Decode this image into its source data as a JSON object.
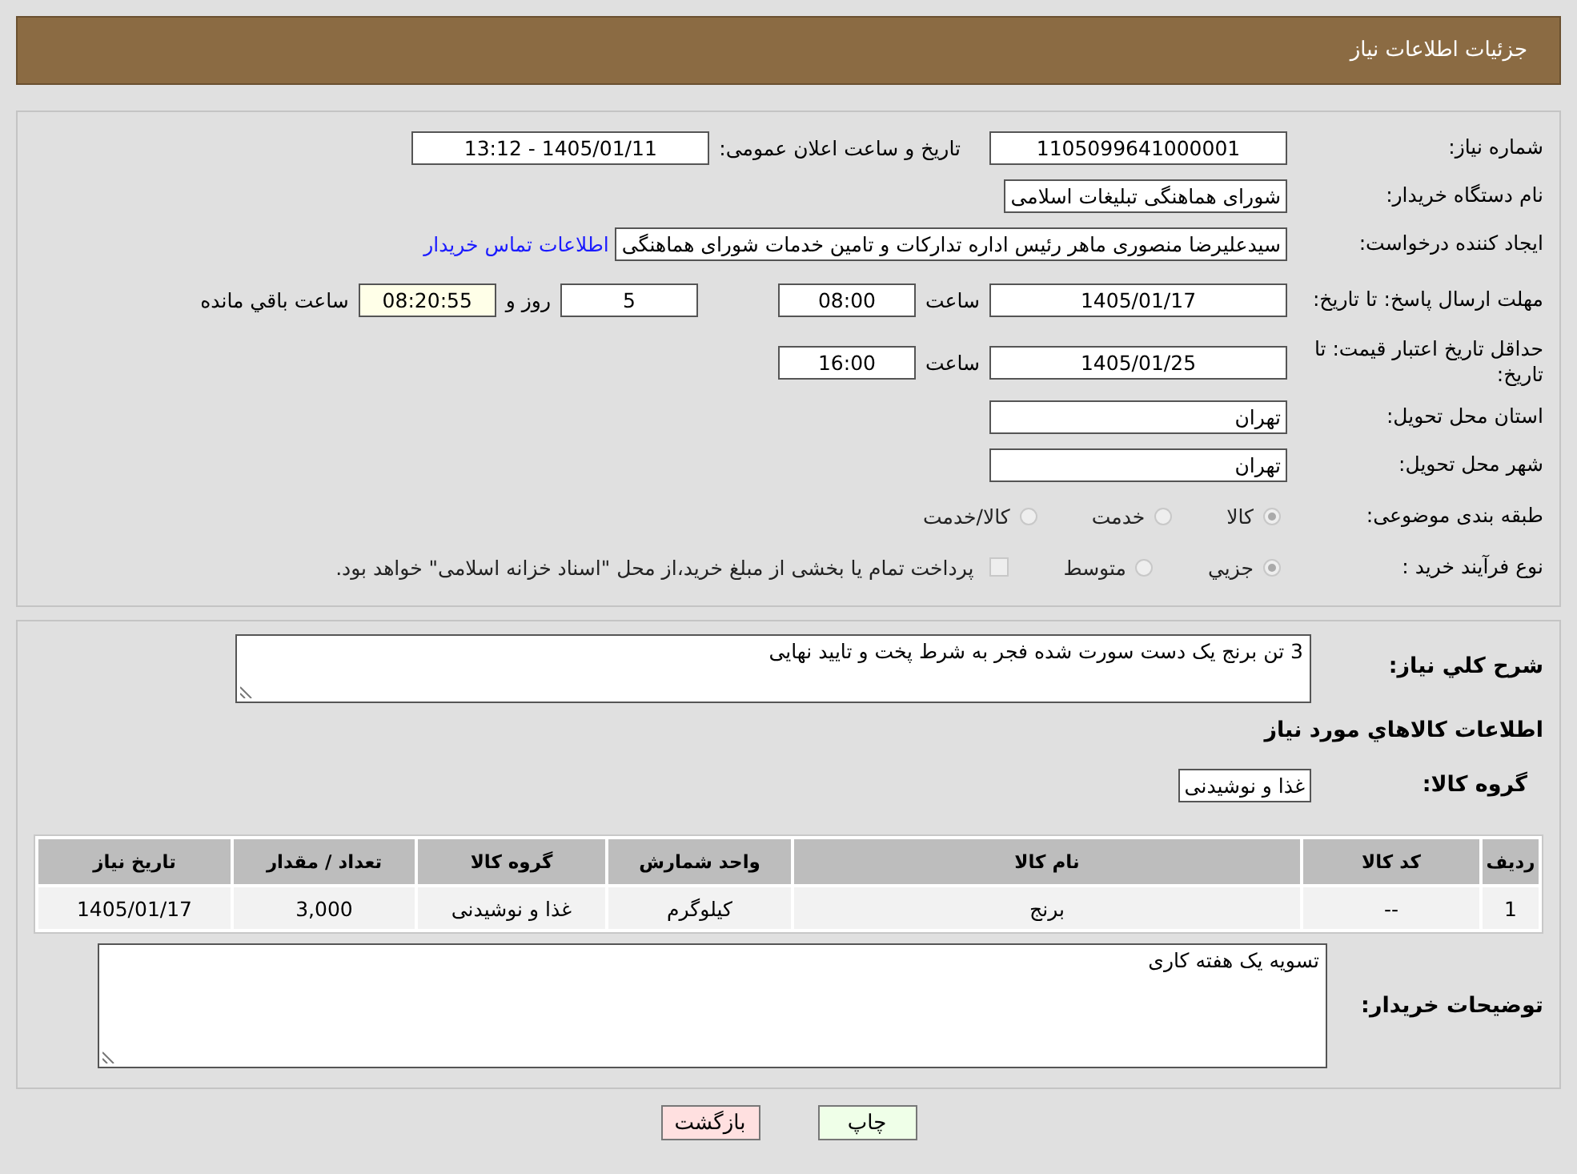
{
  "header": {
    "title": "جزئیات اطلاعات نیاز"
  },
  "need_number": {
    "label": "شماره نیاز:",
    "value": "1105099641000001"
  },
  "announce": {
    "label": "تاریخ و ساعت اعلان عمومی:",
    "value": "1405/01/11 - 13:12"
  },
  "buyer": {
    "label": "نام دستگاه خریدار:",
    "value": "شورای هماهنگی تبلیغات اسلامی"
  },
  "requester": {
    "label": "ایجاد کننده درخواست:",
    "value": "سیدعلیرضا منصوری ماهر رئیس اداره تدارکات و تامین خدمات  شورای هماهنگی",
    "link": "اطلاعات تماس خریدار"
  },
  "reply_deadline": {
    "label": "مهلت ارسال پاسخ: تا تاریخ:",
    "date": "1405/01/17",
    "time_label": "ساعت",
    "time": "08:00",
    "days": "5",
    "days_label": "روز و",
    "remaining": "08:20:55",
    "remaining_label": "ساعت باقي مانده"
  },
  "price_validity": {
    "label": "حداقل تاریخ اعتبار قیمت: تا تاریخ:",
    "date": "1405/01/25",
    "time_label": "ساعت",
    "time": "16:00"
  },
  "province": {
    "label": "استان محل تحویل:",
    "value": "تهران"
  },
  "city": {
    "label": "شهر محل تحویل:",
    "value": "تهران"
  },
  "category": {
    "label": "طبقه بندی موضوعی:",
    "options": [
      {
        "label": "کالا",
        "selected": true
      },
      {
        "label": "خدمت",
        "selected": false
      },
      {
        "label": "کالا/خدمت",
        "selected": false
      }
    ]
  },
  "process": {
    "label": "نوع فرآیند خرید :",
    "options": [
      {
        "label": "جزيي",
        "selected": true
      },
      {
        "label": "متوسط",
        "selected": false
      }
    ],
    "treasury": {
      "label": "پرداخت تمام یا بخشی از مبلغ خرید،از محل \"اسناد خزانه اسلامی\" خواهد بود.",
      "checked": false
    }
  },
  "description": {
    "label": "شرح کلي نیاز:",
    "value": "3 تن برنج یک دست سورت شده فجر به شرط پخت و تایید نهایی"
  },
  "goods_heading": "اطلاعات کالاهاي مورد نیاز",
  "goods_group": {
    "label": "گروه کالا:",
    "value": "غذا و نوشیدنی"
  },
  "table": {
    "columns": [
      "ردیف",
      "کد کالا",
      "نام کالا",
      "واحد شمارش",
      "گروه کالا",
      "تعداد / مقدار",
      "تاریخ نیاز"
    ],
    "rows": [
      [
        "1",
        "--",
        "برنج",
        "کیلوگرم",
        "غذا و نوشیدنی",
        "3,000",
        "1405/01/17"
      ]
    ]
  },
  "buyer_notes": {
    "label": "توضیحات خریدار:",
    "value": "تسویه یک هفته کاری"
  },
  "buttons": [
    {
      "label": "چاپ",
      "kind": "print"
    },
    {
      "label": "بازگشت",
      "kind": "back"
    }
  ]
}
